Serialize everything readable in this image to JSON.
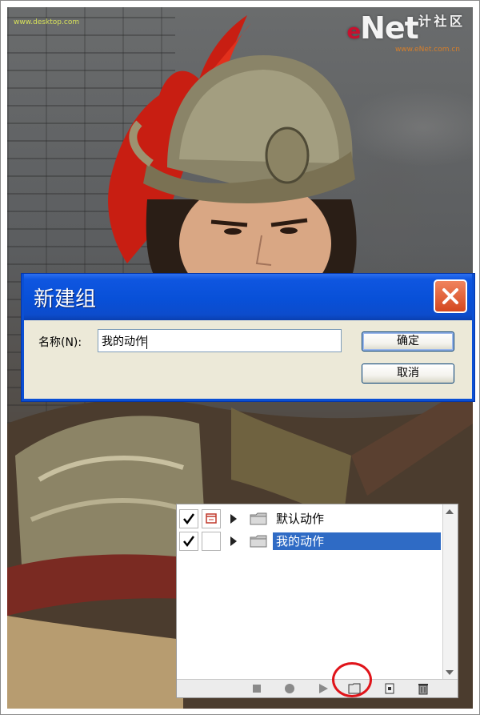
{
  "photo": {
    "watermark": "www.desktop.com",
    "logo_e": "e",
    "logo_main": "Net",
    "logo_side": "计 社 区",
    "logo_sub": "www.eNet.com.cn"
  },
  "dialog": {
    "title": "新建组",
    "name_label": "名称(N):",
    "name_value": "我的动作",
    "ok_label": "确定",
    "cancel_label": "取消"
  },
  "actions_panel": {
    "sets": [
      {
        "label": "默认动作",
        "checked": true,
        "selected": false
      },
      {
        "label": "我的动作",
        "checked": true,
        "selected": true
      }
    ]
  },
  "colors": {
    "titlebar": "#0850d8",
    "selection": "#2f6bc5",
    "highlight_ring": "#e0141a"
  }
}
